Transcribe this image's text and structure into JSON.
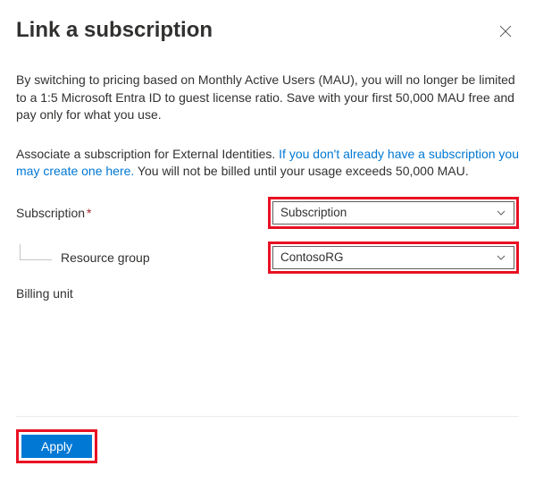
{
  "header": {
    "title": "Link a subscription"
  },
  "intro": "By switching to pricing based on Monthly Active Users (MAU), you will no longer be limited to a 1:5 Microsoft Entra ID to guest license ratio. Save with your first 50,000 MAU free and pay only for what you use.",
  "associate": {
    "pre": "Associate a subscription for External Identities. ",
    "link": "If you don't already have a subscription you may create one here.",
    "post": " You will not be billed until your usage exceeds 50,000 MAU."
  },
  "form": {
    "subscription": {
      "label": "Subscription",
      "required": "*",
      "value": "Subscription"
    },
    "resource_group": {
      "label": "Resource group",
      "value": "ContosoRG"
    },
    "billing_unit": {
      "label": "Billing unit"
    }
  },
  "footer": {
    "apply_label": "Apply"
  }
}
